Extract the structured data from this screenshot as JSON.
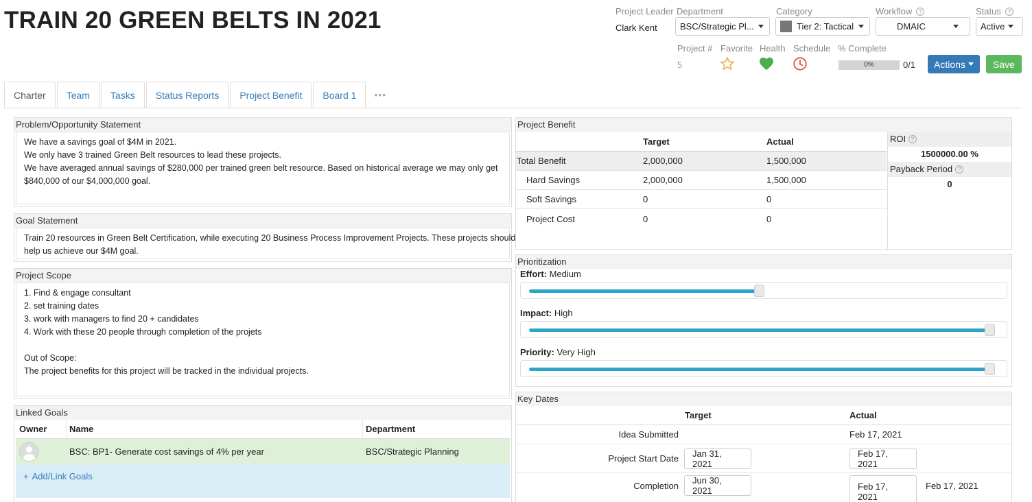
{
  "project": {
    "title": "TRAIN 20 GREEN BELTS IN 2021"
  },
  "header": {
    "leader_label": "Project Leader",
    "leader_value": "Clark Kent",
    "department_label": "Department",
    "department_value": "BSC/Strategic Pl...",
    "category_label": "Category",
    "category_value": "Tier 2: Tactical",
    "category_swatch": "#777777",
    "workflow_label": "Workflow",
    "workflow_value": "DMAIC",
    "status_label": "Status",
    "status_value": "Active",
    "project_num_label": "Project #",
    "project_num_value": "5",
    "favorite_label": "Favorite",
    "health_label": "Health",
    "schedule_label": "Schedule",
    "complete_label": "% Complete",
    "complete_pct_text": "0%",
    "complete_ratio": "0/1",
    "complete_fraction": 0,
    "actions_label": "Actions",
    "save_label": "Save",
    "actions_color": "#337ab7",
    "save_color": "#5cb85c",
    "health_color": "#4cae4c",
    "schedule_color": "#d9534f",
    "favorite_color": "#f0ad4e"
  },
  "tabs": [
    "Charter",
    "Team",
    "Tasks",
    "Status Reports",
    "Project Benefit",
    "Board 1"
  ],
  "problem": {
    "heading": "Problem/Opportunity Statement",
    "lines": [
      "We have a savings goal of $4M in 2021.",
      "We only have 3 trained Green Belt resources to lead these projects.",
      "We have averaged annual savings of $280,000 per trained green belt resource. Based on historical average we may only get",
      "$840,000 of our $4,000,000 goal."
    ]
  },
  "goal": {
    "heading": "Goal Statement",
    "lines": [
      "Train 20 resources in Green Belt Certification, while executing 20 Business Process Improvement Projects. These projects should",
      "help us achieve our $4M goal."
    ]
  },
  "scope": {
    "heading": "Project Scope",
    "lines": [
      "1. Find & engage consultant",
      "2. set training dates",
      "3. work with managers to find 20 + candidates",
      "4. Work with these 20 people through completion of the projets",
      "",
      "Out of Scope:",
      "The project benefits for this project will be tracked in the individual projects."
    ]
  },
  "linked_goals": {
    "heading": "Linked Goals",
    "col_owner": "Owner",
    "col_name": "Name",
    "col_department": "Department",
    "row_name": "BSC: BP1- Generate cost savings of 4% per year",
    "row_department": "BSC/Strategic Planning",
    "add_label": "Add/Link Goals"
  },
  "benefit": {
    "heading": "Project Benefit",
    "col_target": "Target",
    "col_actual": "Actual",
    "rows": [
      {
        "label": "Total Benefit",
        "target": "2,000,000",
        "actual": "1,500,000"
      },
      {
        "label": "Hard Savings",
        "target": "2,000,000",
        "actual": "1,500,000"
      },
      {
        "label": "Soft Savings",
        "target": "0",
        "actual": "0"
      },
      {
        "label": "Project Cost",
        "target": "0",
        "actual": "0"
      }
    ],
    "roi_label": "ROI",
    "roi_value": "1500000.00 %",
    "payback_label": "Payback Period",
    "payback_value": "0"
  },
  "prioritization": {
    "heading": "Prioritization",
    "effort_label": "Effort:",
    "effort_value": "Medium",
    "effort_level": 0.5,
    "impact_label": "Impact:",
    "impact_value": "High",
    "impact_level": 1.0,
    "priority_label": "Priority:",
    "priority_value": "Very High",
    "priority_level": 1.0
  },
  "key_dates": {
    "heading": "Key Dates",
    "col_target": "Target",
    "col_actual": "Actual",
    "idea_label": "Idea Submitted",
    "idea_actual": "Feb 17, 2021",
    "start_label": "Project Start Date",
    "start_target": "Jan 31, 2021",
    "start_actual": "Feb 17, 2021",
    "completion_label": "Completion",
    "completion_target": "Jun 30, 2021",
    "completion_actual": "Feb 17, 2021",
    "completion_extra": "Feb 17, 2021"
  }
}
